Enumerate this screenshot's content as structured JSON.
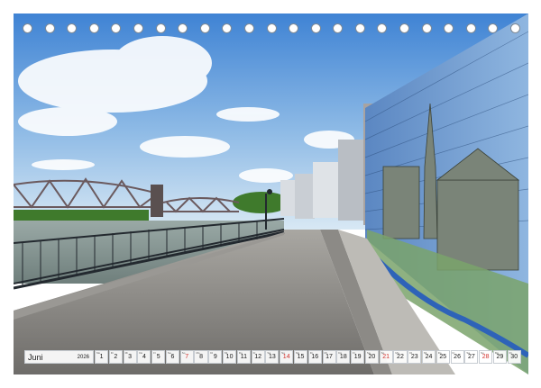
{
  "calendar": {
    "month": "Juni",
    "year": "2026",
    "days": [
      {
        "n": "1",
        "wd": "Mo",
        "sun": false
      },
      {
        "n": "2",
        "wd": "Di",
        "sun": false
      },
      {
        "n": "3",
        "wd": "Mi",
        "sun": false
      },
      {
        "n": "4",
        "wd": "Do",
        "sun": false
      },
      {
        "n": "5",
        "wd": "Fr",
        "sun": false
      },
      {
        "n": "6",
        "wd": "Sa",
        "sun": false
      },
      {
        "n": "7",
        "wd": "So",
        "sun": true
      },
      {
        "n": "8",
        "wd": "Mo",
        "sun": false
      },
      {
        "n": "9",
        "wd": "Di",
        "sun": false
      },
      {
        "n": "10",
        "wd": "Mi",
        "sun": false
      },
      {
        "n": "11",
        "wd": "Do",
        "sun": false
      },
      {
        "n": "12",
        "wd": "Fr",
        "sun": false
      },
      {
        "n": "13",
        "wd": "Sa",
        "sun": false
      },
      {
        "n": "14",
        "wd": "So",
        "sun": true
      },
      {
        "n": "15",
        "wd": "Mo",
        "sun": false
      },
      {
        "n": "16",
        "wd": "Di",
        "sun": false
      },
      {
        "n": "17",
        "wd": "Mi",
        "sun": false
      },
      {
        "n": "18",
        "wd": "Do",
        "sun": false
      },
      {
        "n": "19",
        "wd": "Fr",
        "sun": false
      },
      {
        "n": "20",
        "wd": "Sa",
        "sun": false
      },
      {
        "n": "21",
        "wd": "So",
        "sun": true
      },
      {
        "n": "22",
        "wd": "Mo",
        "sun": false
      },
      {
        "n": "23",
        "wd": "Di",
        "sun": false
      },
      {
        "n": "24",
        "wd": "Mi",
        "sun": false
      },
      {
        "n": "25",
        "wd": "Do",
        "sun": false
      },
      {
        "n": "26",
        "wd": "Fr",
        "sun": false
      },
      {
        "n": "27",
        "wd": "Sa",
        "sun": false
      },
      {
        "n": "28",
        "wd": "So",
        "sun": true
      },
      {
        "n": "29",
        "wd": "Mo",
        "sun": false
      },
      {
        "n": "30",
        "wd": "Di",
        "sun": false
      }
    ]
  },
  "binding": {
    "hole_count": 23
  },
  "colors": {
    "sunday": "#d2322d",
    "sky": "#4f8fd6",
    "mural_blue": "#3f6fb0"
  }
}
